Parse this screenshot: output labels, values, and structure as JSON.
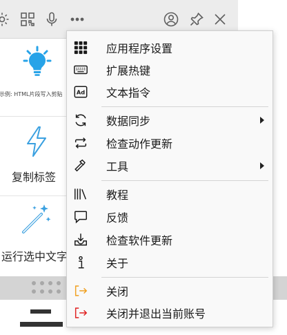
{
  "toolbar": {
    "icons": [
      "gear-icon",
      "qr-code-icon",
      "microphone-icon",
      "more-icon",
      "account-icon",
      "pin-icon",
      "close-icon"
    ]
  },
  "cells": {
    "snippet_caption": "示例: HTML片段写入剪贴",
    "copy_tags_label": "复制标签",
    "run_selected_label": "运行选中文字"
  },
  "menu": {
    "items": [
      {
        "label": "应用程序设置",
        "icon": "apps-grid-icon"
      },
      {
        "label": "扩展热键",
        "icon": "keyboard-icon"
      },
      {
        "label": "文本指令",
        "icon": "ad-icon"
      },
      {
        "label": "数据同步",
        "icon": "sync-icon",
        "submenu": true
      },
      {
        "label": "检查动作更新",
        "icon": "repeat-icon"
      },
      {
        "label": "工具",
        "icon": "hammer-icon",
        "submenu": true
      },
      {
        "label": "教程",
        "icon": "books-icon"
      },
      {
        "label": "反馈",
        "icon": "feedback-icon"
      },
      {
        "label": "检查软件更新",
        "icon": "download-icon"
      },
      {
        "label": "关于",
        "icon": "info-icon"
      },
      {
        "label": "关闭",
        "icon": "close-window-icon",
        "color": "#f0a020"
      },
      {
        "label": "关闭并退出当前账号",
        "icon": "logout-icon",
        "color": "#e02020"
      }
    ]
  }
}
